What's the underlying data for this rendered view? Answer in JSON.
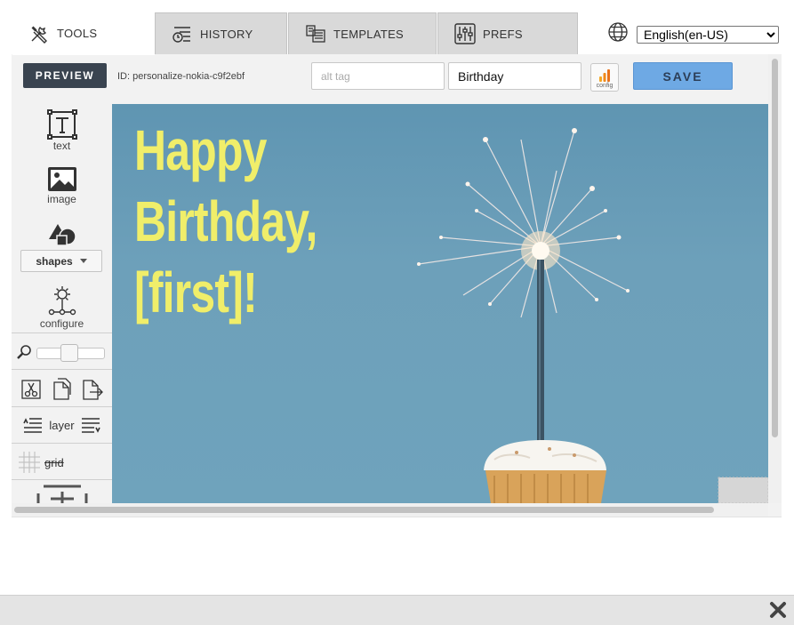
{
  "tabs": [
    {
      "label": "TOOLS",
      "icon": "tools-icon",
      "active": true
    },
    {
      "label": "HISTORY",
      "icon": "history-icon",
      "active": false
    },
    {
      "label": "TEMPLATES",
      "icon": "templates-icon",
      "active": false
    },
    {
      "label": "PREFS",
      "icon": "sliders-icon",
      "active": false
    }
  ],
  "language": {
    "selected": "English(en-US)",
    "icon": "globe-icon"
  },
  "topbar": {
    "preview_label": "PREVIEW",
    "id_text": "ID: personalize-nokia-c9f2ebf",
    "alt_placeholder": "alt tag",
    "name_value": "Birthday",
    "config_label": "config",
    "save_label": "SAVE"
  },
  "toolbox": {
    "text_label": "text",
    "image_label": "image",
    "shapes_label": "shapes",
    "configure_label": "configure",
    "layer_label": "layer",
    "grid_label": "grid",
    "zoom_level": 0.5
  },
  "canvas": {
    "line1": "Happy",
    "line2": "Birthday,",
    "line3": "[first]!",
    "text_color": "#f0ee6a",
    "background_color": "#6a9db8"
  },
  "colors": {
    "preview_button": "#3a4450",
    "save_button": "#6ea9e4",
    "tab_inactive": "#d9d9d9"
  }
}
